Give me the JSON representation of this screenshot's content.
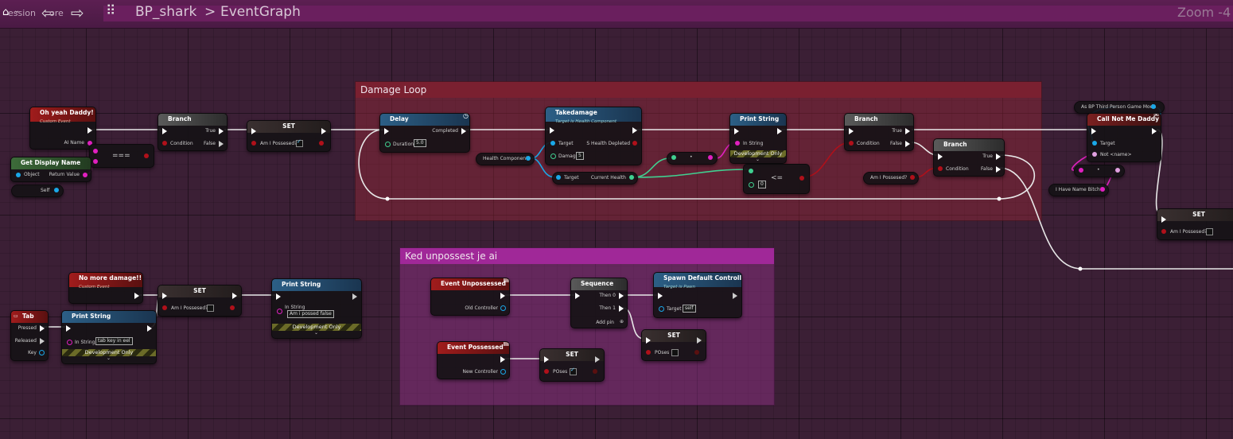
{
  "topbar": {
    "title_partial": "ession",
    "title_partial2": "ore",
    "blueprint": "BP_shark",
    "separator": ">",
    "graph": "EventGraph",
    "zoom": "Zoom -4"
  },
  "comments": {
    "damage_loop": "Damage Loop",
    "unpossess": "Ked unpossest  je ai"
  },
  "nodes": {
    "oh_yeah": {
      "title": "Oh yeah Daddy!",
      "sub": "Custom Event",
      "pin": "AI Name"
    },
    "get_display_name": {
      "title": "Get Display Name",
      "object": "Object",
      "ret": "Return Value",
      "self": "Self"
    },
    "equals": {
      "title": "==="
    },
    "branch1": {
      "title": "Branch",
      "cond": "Condition",
      "true": "True",
      "false": "False"
    },
    "set1": {
      "title": "SET",
      "var": "Am I Possesed?"
    },
    "delay": {
      "title": "Delay",
      "duration": "Duration",
      "duration_val": "5.0",
      "completed": "Completed"
    },
    "health_component": {
      "title": "Health Component"
    },
    "takedamage": {
      "title": "Takedamage",
      "sub": "Target is Health Component",
      "target": "Target",
      "damage": "Damage",
      "damage_val": "5",
      "depleted": "S Health Depleted"
    },
    "current_health": {
      "target": "Target",
      "val": "Current Health"
    },
    "print1": {
      "title": "Print String",
      "in": "In String",
      "dev": "Development Only"
    },
    "lessequal": {
      "op": "<=",
      "val": "0"
    },
    "branch2": {
      "title": "Branch",
      "cond": "Condition",
      "true": "True",
      "false": "False"
    },
    "am_possessed_get": {
      "title": "Am I Possesed?"
    },
    "branch3": {
      "title": "Branch",
      "cond": "Condition",
      "true": "True",
      "false": "False"
    },
    "as_bp": {
      "title": "As BP Third Person Game Mode"
    },
    "call_not_me": {
      "title": "Call Not Me Daddy",
      "target": "Target",
      "name": "Not <name>"
    },
    "i_have_name": {
      "title": "I Have Name Bitch!"
    },
    "set_right": {
      "title": "SET",
      "var": "Am I Possesed?"
    },
    "no_more_damage": {
      "title": "No more damage!!!",
      "sub": "Custom Event"
    },
    "set2": {
      "title": "SET",
      "var": "Am I Possesed?"
    },
    "print2": {
      "title": "Print String",
      "in": "In String",
      "val": "Am i possed false",
      "dev": "Development Only"
    },
    "tab": {
      "title": "Tab",
      "pressed": "Pressed",
      "released": "Released",
      "key": "Key"
    },
    "print3": {
      "title": "Print String",
      "in": "In String",
      "val": "tab key in eel",
      "dev": "Development Only"
    },
    "event_unpossessed": {
      "title": "Event Unpossessed",
      "pin": "Old Controller"
    },
    "sequence": {
      "title": "Sequence",
      "then0": "Then 0",
      "then1": "Then 1",
      "add": "Add pin"
    },
    "spawn_default": {
      "title": "Spawn Default Controller",
      "sub": "Target is Pawn",
      "target": "Target",
      "self": "self"
    },
    "set_poses1": {
      "title": "SET",
      "var": "POses"
    },
    "event_possessed": {
      "title": "Event Possessed",
      "pin": "New Controller"
    },
    "set_poses2": {
      "title": "SET",
      "var": "POses"
    }
  }
}
